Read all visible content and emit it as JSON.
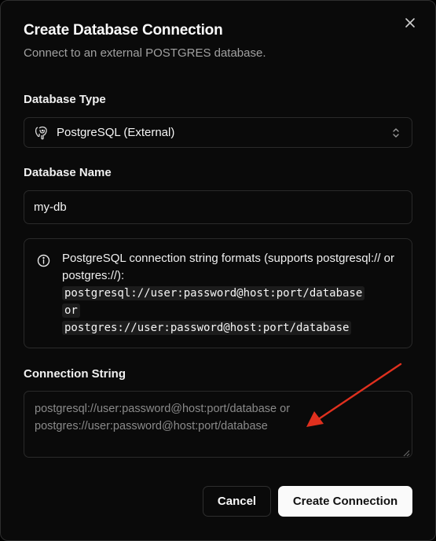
{
  "dialog": {
    "title": "Create Database Connection",
    "subtitle": "Connect to an external POSTGRES database."
  },
  "database_type": {
    "label": "Database Type",
    "selected": "PostgreSQL (External)",
    "icon": "postgresql-elephant-icon"
  },
  "database_name": {
    "label": "Database Name",
    "value": "my-db"
  },
  "info_alert": {
    "icon": "info-icon",
    "text": "PostgreSQL connection string formats (supports postgresql:// or postgres://):",
    "format_1": "postgresql://user:password@host:port/database",
    "or_text": "or",
    "format_2": "postgres://user:password@host:port/database"
  },
  "connection_string": {
    "label": "Connection String",
    "value": "",
    "placeholder": "postgresql://user:password@host:port/database or postgres://user:password@host:port/database"
  },
  "actions": {
    "cancel_label": "Cancel",
    "create_label": "Create Connection"
  },
  "colors": {
    "background": "#0a0a0a",
    "border": "#2a2a2a",
    "primary_button": "#fafafa",
    "annotation_arrow": "#e0301e"
  }
}
